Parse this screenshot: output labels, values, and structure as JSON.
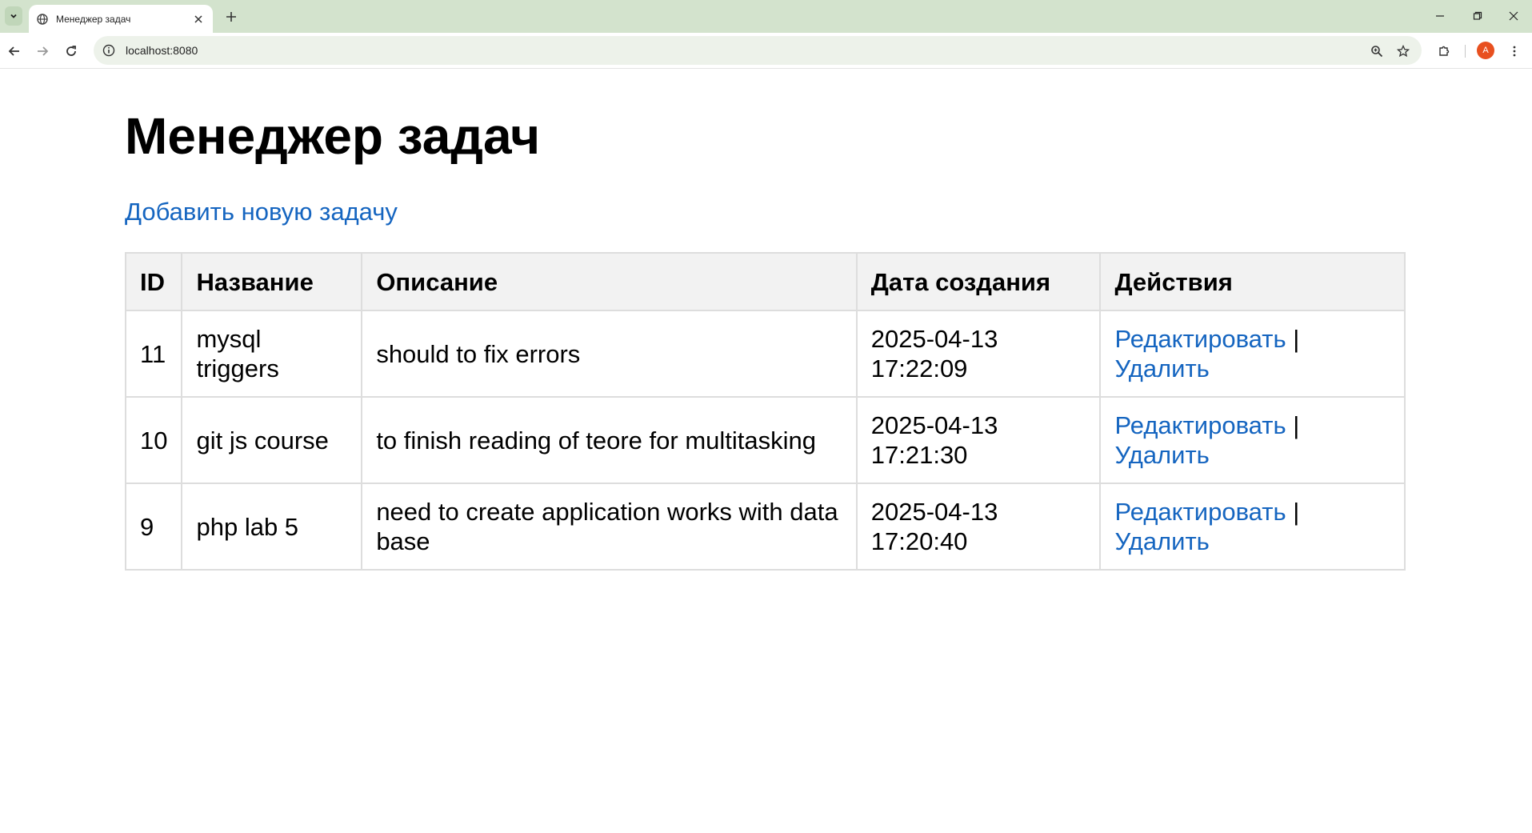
{
  "browser": {
    "tab_title": "Менеджер задач",
    "url": "localhost:8080",
    "profile_initial": "A"
  },
  "page": {
    "title": "Менеджер задач",
    "add_link": "Добавить новую задачу",
    "table": {
      "headers": [
        "ID",
        "Название",
        "Описание",
        "Дата создания",
        "Действия"
      ],
      "rows": [
        {
          "id": "11",
          "name": "mysql triggers",
          "description": "should to fix errors",
          "date": "2025-04-13 17:22:09"
        },
        {
          "id": "10",
          "name": "git js course",
          "description": "to finish reading of teore for multitasking",
          "date": "2025-04-13 17:21:30"
        },
        {
          "id": "9",
          "name": "php lab 5",
          "description": "need to create application works with data base",
          "date": "2025-04-13 17:20:40"
        }
      ],
      "edit_label": "Редактировать",
      "separator": "|",
      "delete_label": "Удалить"
    }
  },
  "colors": {
    "link": "#1565c0",
    "header_bg": "#f2f2f2",
    "border": "#dddddd",
    "chrome_bg": "#d3e3cd"
  }
}
